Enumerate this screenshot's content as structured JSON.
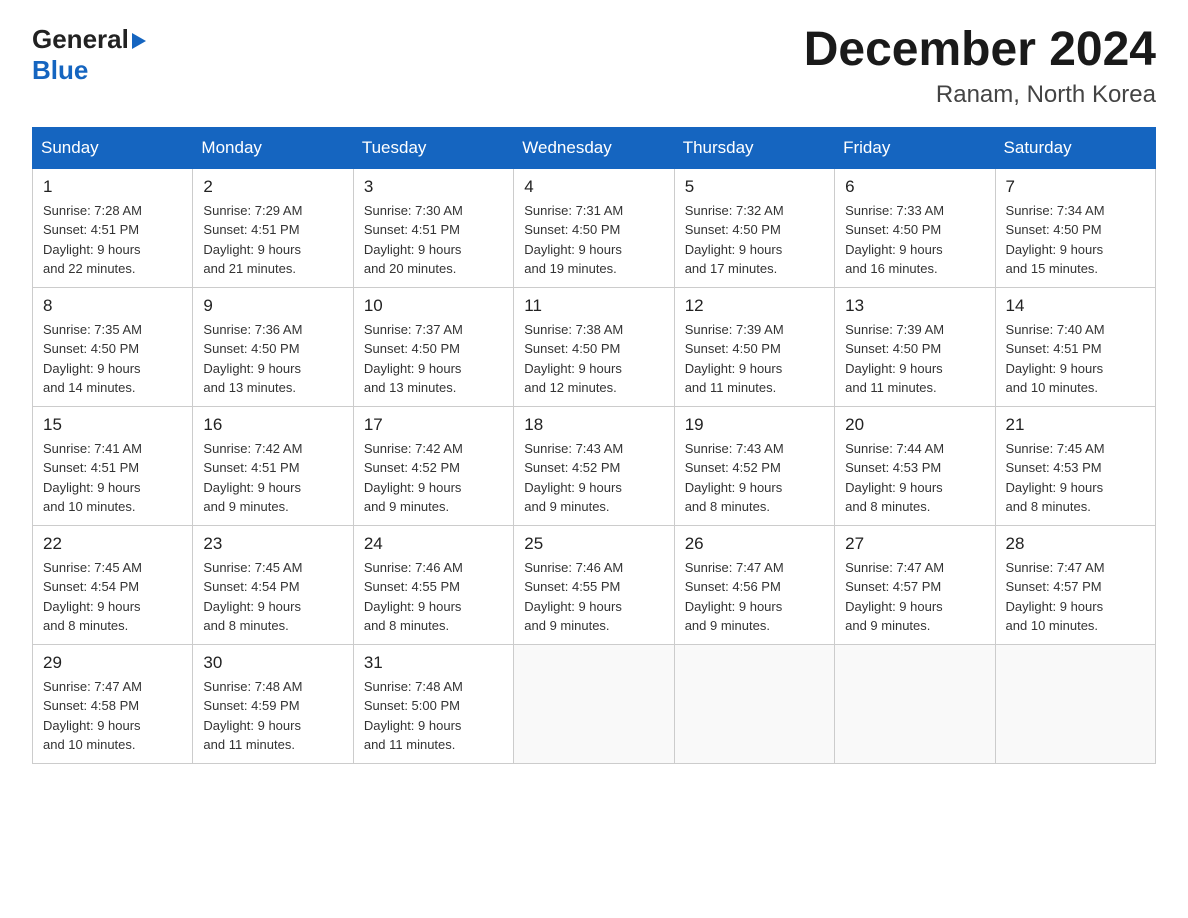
{
  "header": {
    "title": "December 2024",
    "subtitle": "Ranam, North Korea",
    "logo_general": "General",
    "logo_blue": "Blue"
  },
  "days_of_week": [
    "Sunday",
    "Monday",
    "Tuesday",
    "Wednesday",
    "Thursday",
    "Friday",
    "Saturday"
  ],
  "weeks": [
    [
      {
        "num": "1",
        "info": "Sunrise: 7:28 AM\nSunset: 4:51 PM\nDaylight: 9 hours\nand 22 minutes."
      },
      {
        "num": "2",
        "info": "Sunrise: 7:29 AM\nSunset: 4:51 PM\nDaylight: 9 hours\nand 21 minutes."
      },
      {
        "num": "3",
        "info": "Sunrise: 7:30 AM\nSunset: 4:51 PM\nDaylight: 9 hours\nand 20 minutes."
      },
      {
        "num": "4",
        "info": "Sunrise: 7:31 AM\nSunset: 4:50 PM\nDaylight: 9 hours\nand 19 minutes."
      },
      {
        "num": "5",
        "info": "Sunrise: 7:32 AM\nSunset: 4:50 PM\nDaylight: 9 hours\nand 17 minutes."
      },
      {
        "num": "6",
        "info": "Sunrise: 7:33 AM\nSunset: 4:50 PM\nDaylight: 9 hours\nand 16 minutes."
      },
      {
        "num": "7",
        "info": "Sunrise: 7:34 AM\nSunset: 4:50 PM\nDaylight: 9 hours\nand 15 minutes."
      }
    ],
    [
      {
        "num": "8",
        "info": "Sunrise: 7:35 AM\nSunset: 4:50 PM\nDaylight: 9 hours\nand 14 minutes."
      },
      {
        "num": "9",
        "info": "Sunrise: 7:36 AM\nSunset: 4:50 PM\nDaylight: 9 hours\nand 13 minutes."
      },
      {
        "num": "10",
        "info": "Sunrise: 7:37 AM\nSunset: 4:50 PM\nDaylight: 9 hours\nand 13 minutes."
      },
      {
        "num": "11",
        "info": "Sunrise: 7:38 AM\nSunset: 4:50 PM\nDaylight: 9 hours\nand 12 minutes."
      },
      {
        "num": "12",
        "info": "Sunrise: 7:39 AM\nSunset: 4:50 PM\nDaylight: 9 hours\nand 11 minutes."
      },
      {
        "num": "13",
        "info": "Sunrise: 7:39 AM\nSunset: 4:50 PM\nDaylight: 9 hours\nand 11 minutes."
      },
      {
        "num": "14",
        "info": "Sunrise: 7:40 AM\nSunset: 4:51 PM\nDaylight: 9 hours\nand 10 minutes."
      }
    ],
    [
      {
        "num": "15",
        "info": "Sunrise: 7:41 AM\nSunset: 4:51 PM\nDaylight: 9 hours\nand 10 minutes."
      },
      {
        "num": "16",
        "info": "Sunrise: 7:42 AM\nSunset: 4:51 PM\nDaylight: 9 hours\nand 9 minutes."
      },
      {
        "num": "17",
        "info": "Sunrise: 7:42 AM\nSunset: 4:52 PM\nDaylight: 9 hours\nand 9 minutes."
      },
      {
        "num": "18",
        "info": "Sunrise: 7:43 AM\nSunset: 4:52 PM\nDaylight: 9 hours\nand 9 minutes."
      },
      {
        "num": "19",
        "info": "Sunrise: 7:43 AM\nSunset: 4:52 PM\nDaylight: 9 hours\nand 8 minutes."
      },
      {
        "num": "20",
        "info": "Sunrise: 7:44 AM\nSunset: 4:53 PM\nDaylight: 9 hours\nand 8 minutes."
      },
      {
        "num": "21",
        "info": "Sunrise: 7:45 AM\nSunset: 4:53 PM\nDaylight: 9 hours\nand 8 minutes."
      }
    ],
    [
      {
        "num": "22",
        "info": "Sunrise: 7:45 AM\nSunset: 4:54 PM\nDaylight: 9 hours\nand 8 minutes."
      },
      {
        "num": "23",
        "info": "Sunrise: 7:45 AM\nSunset: 4:54 PM\nDaylight: 9 hours\nand 8 minutes."
      },
      {
        "num": "24",
        "info": "Sunrise: 7:46 AM\nSunset: 4:55 PM\nDaylight: 9 hours\nand 8 minutes."
      },
      {
        "num": "25",
        "info": "Sunrise: 7:46 AM\nSunset: 4:55 PM\nDaylight: 9 hours\nand 9 minutes."
      },
      {
        "num": "26",
        "info": "Sunrise: 7:47 AM\nSunset: 4:56 PM\nDaylight: 9 hours\nand 9 minutes."
      },
      {
        "num": "27",
        "info": "Sunrise: 7:47 AM\nSunset: 4:57 PM\nDaylight: 9 hours\nand 9 minutes."
      },
      {
        "num": "28",
        "info": "Sunrise: 7:47 AM\nSunset: 4:57 PM\nDaylight: 9 hours\nand 10 minutes."
      }
    ],
    [
      {
        "num": "29",
        "info": "Sunrise: 7:47 AM\nSunset: 4:58 PM\nDaylight: 9 hours\nand 10 minutes."
      },
      {
        "num": "30",
        "info": "Sunrise: 7:48 AM\nSunset: 4:59 PM\nDaylight: 9 hours\nand 11 minutes."
      },
      {
        "num": "31",
        "info": "Sunrise: 7:48 AM\nSunset: 5:00 PM\nDaylight: 9 hours\nand 11 minutes."
      },
      {
        "num": "",
        "info": ""
      },
      {
        "num": "",
        "info": ""
      },
      {
        "num": "",
        "info": ""
      },
      {
        "num": "",
        "info": ""
      }
    ]
  ],
  "colors": {
    "header_bg": "#1565C0",
    "logo_blue": "#1565C0"
  }
}
